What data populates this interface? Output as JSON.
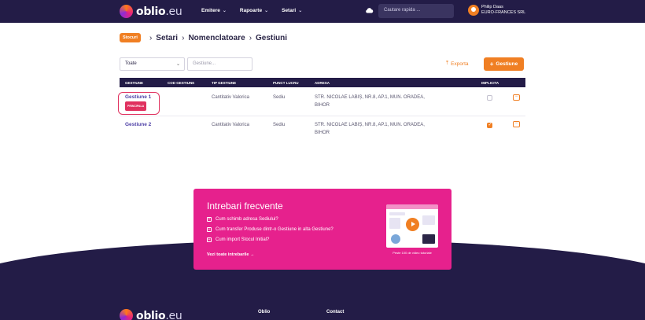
{
  "nav": {
    "logo_main": "oblio",
    "logo_suffix": ".eu",
    "menu": [
      {
        "label": "Emitere"
      },
      {
        "label": "Rapoarte"
      },
      {
        "label": "Setari"
      }
    ],
    "search_placeholder": "Cautare rapida ...",
    "user_name": "Philip Daas",
    "user_company": "EURO-FRANCES SRL"
  },
  "breadcrumb": {
    "tag": "Stocuri",
    "items": [
      "Setari",
      "Nomenclatoare",
      "Gestiuni"
    ],
    "separator": "›"
  },
  "toolbar": {
    "filter_value": "Toate",
    "search_placeholder": "Gestiune...",
    "export_label": "Exporta",
    "add_label": "Gestiune"
  },
  "table": {
    "headers": [
      "GESTIUNE",
      "COD GESTIUNE",
      "TIP GESTIUNE",
      "PUNCT LUCRU",
      "ADRESA",
      "IMPLICITA"
    ],
    "rows": [
      {
        "name": "Gestiune 1",
        "badge": "PRINCIPALA",
        "code": "",
        "type": "Cantitativ Valorica",
        "workpoint": "Sediu",
        "address_line1": "STR. NICOLAE LABIȘ, NR.8, AP.1, MUN. ORADEA,",
        "address_line2": "BIHOR",
        "default": false
      },
      {
        "name": "Gestiune 2",
        "badge": "",
        "code": "",
        "type": "Cantitativ Valorica",
        "workpoint": "Sediu",
        "address_line1": "STR. NICOLAE LABIȘ, NR.8, AP.1, MUN. ORADEA,",
        "address_line2": "BIHOR",
        "default": true
      }
    ]
  },
  "faq": {
    "title": "Intrebari frecvente",
    "items": [
      "Cum schimb adresa Sediului?",
      "Cum transfer Produse dintr-o Gestiune in alta Gestiune?",
      "Cum import Stocul Initial?"
    ],
    "see_all": "Vezi toate intrebarile  →",
    "video_caption": "Peste 100 de video tutoriale"
  },
  "footer": {
    "columns": [
      "Oblio",
      "Contact"
    ]
  },
  "colors": {
    "nav_bg": "#231c47",
    "accent": "#f07f23",
    "faq_bg": "#e6218d",
    "badge": "#e0315f"
  }
}
